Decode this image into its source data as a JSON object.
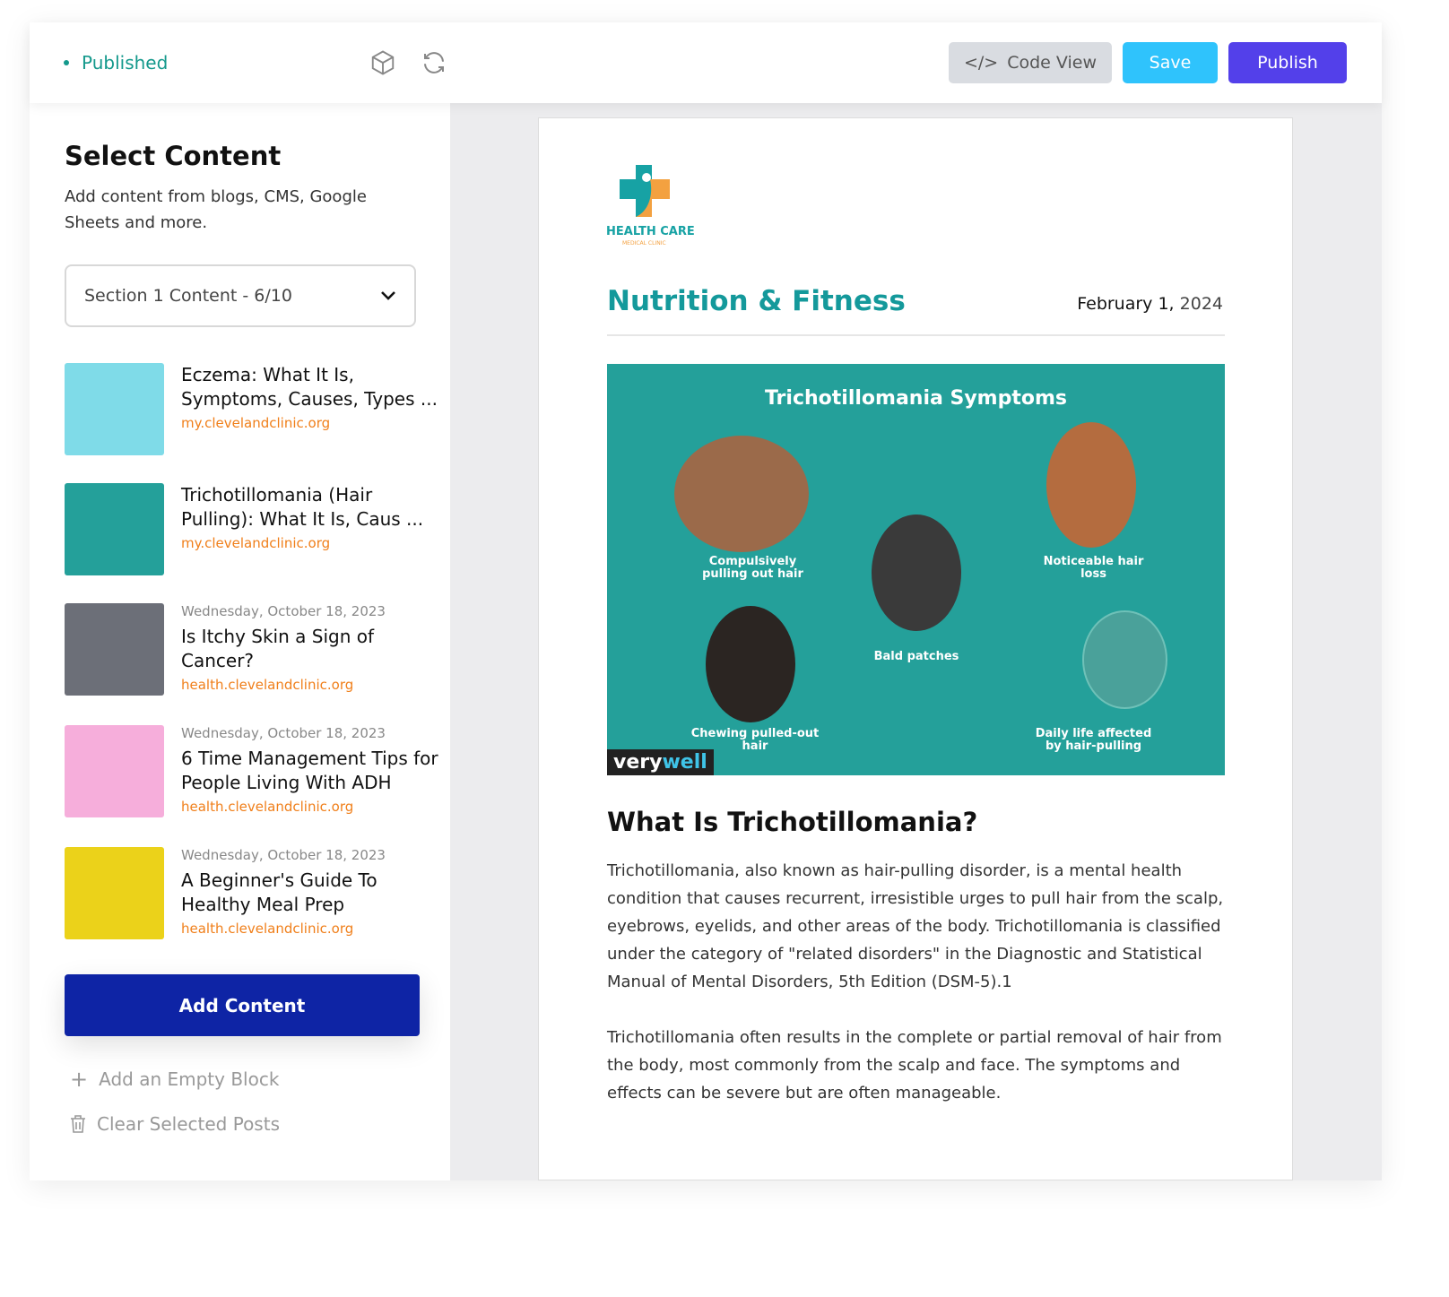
{
  "header": {
    "status": "Published",
    "icons": [
      "cube-icon",
      "refresh-icon"
    ],
    "code_view": "Code View",
    "save": "Save",
    "publish": "Publish"
  },
  "sidebar": {
    "title": "Select Content",
    "subtitle": "Add content from blogs, CMS, Google Sheets and more.",
    "section_select": "Section 1 Content - 6/10",
    "items": [
      {
        "date": "",
        "title": "Eczema: What It Is, Symptoms, Causes, Types ...",
        "source": "my.clevelandclinic.org",
        "thumb_color": "#7fdbe8"
      },
      {
        "date": "",
        "title": "Trichotillomania (Hair Pulling): What It Is, Caus ...",
        "source": "my.clevelandclinic.org",
        "thumb_color": "#24a09a"
      },
      {
        "date": "Wednesday, October 18, 2023",
        "title": "Is Itchy Skin a Sign of Cancer?",
        "source": "health.clevelandclinic.org",
        "thumb_color": "#6c6f78"
      },
      {
        "date": "Wednesday, October 18, 2023",
        "title": "6 Time Management Tips for People Living With ADH",
        "source": "health.clevelandclinic.org",
        "thumb_color": "#f6aedb"
      },
      {
        "date": "Wednesday, October 18, 2023",
        "title": "A Beginner's Guide To Healthy Meal Prep",
        "source": "health.clevelandclinic.org",
        "thumb_color": "#ebd21a"
      }
    ],
    "add_content": "Add Content",
    "add_empty": "Add an Empty Block",
    "clear": "Clear Selected Posts"
  },
  "preview": {
    "logo": {
      "name": "HEALTH CARE",
      "tagline": "MEDICAL CLINIC"
    },
    "category": "Nutrition & Fitness",
    "date_month_day": "February 1,",
    "date_year": "2024",
    "hero": {
      "title": "Trichotillomania Symptoms",
      "labels": [
        "Compulsively pulling out hair",
        "Noticeable hair loss",
        "Bald patches",
        "Chewing pulled-out hair",
        "Daily life affected by hair-pulling"
      ],
      "brand_a": "very",
      "brand_b": "well"
    },
    "heading": "What Is Trichotillomania?",
    "paragraphs": [
      "Trichotillomania, also known as hair-pulling disorder, is a mental health condition that causes recurrent, irresistible urges to pull hair from the scalp, eyebrows, eyelids, and other areas of the body. Trichotillomania is classified under the category of \"related disorders\" in the Diagnostic and Statistical Manual of Mental Disorders, 5th Edition (DSM-5).1",
      "Trichotillomania often results in the complete or partial removal of hair from the body, most commonly from the scalp and face. The symptoms and effects can be severe but are often manageable."
    ]
  },
  "colors": {
    "published": "#14998c",
    "save": "#2fc3fc",
    "publish": "#5340ea",
    "add_content": "#0e24a5",
    "source": "#f07f1a",
    "category": "#14999b"
  }
}
